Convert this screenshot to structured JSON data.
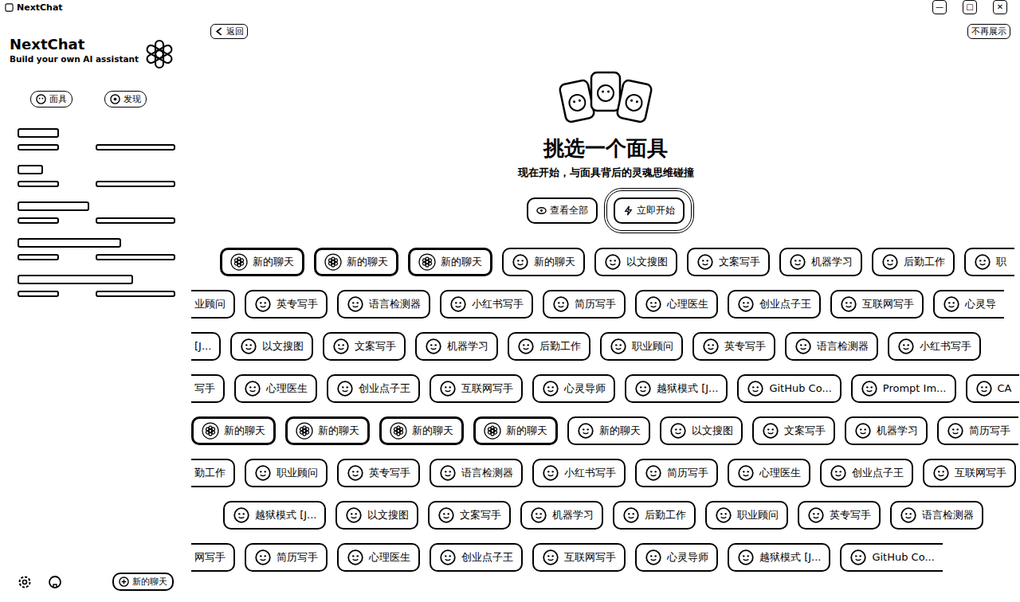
{
  "window": {
    "title": "NextChat",
    "controls": [
      "—",
      "□",
      "✕"
    ]
  },
  "sidebar": {
    "title": "NextChat",
    "subtitle": "Build your own AI assistant",
    "buttons": [
      {
        "label": "面具"
      },
      {
        "label": "发现"
      }
    ],
    "chats": [
      {
        "selected": false
      },
      {
        "selected": false
      },
      {
        "selected": false
      },
      {
        "selected": false
      },
      {
        "selected": false
      }
    ],
    "new_chat": "新的聊天"
  },
  "header": {
    "back": "返回",
    "dismiss": "不再展示"
  },
  "hero": {
    "title": "挑选一个面具",
    "subtitle": "现在开始，与面具背后的灵魂思维碰撞",
    "buttons": [
      {
        "label": "查看全部",
        "selected": false
      },
      {
        "label": "立即开始",
        "selected": true
      }
    ]
  },
  "mask_rows": [
    [
      {
        "label": "新的聊天",
        "kind": "gpt",
        "cut": "none"
      },
      {
        "label": "新的聊天",
        "kind": "gpt",
        "cut": "none"
      },
      {
        "label": "新的聊天",
        "kind": "gpt",
        "cut": "none"
      },
      {
        "label": "新的聊天",
        "kind": "emoji",
        "cut": "none"
      },
      {
        "label": "以文搜图",
        "kind": "emoji",
        "cut": "none"
      },
      {
        "label": "文案写手",
        "kind": "emoji",
        "cut": "none"
      },
      {
        "label": "机器学习",
        "kind": "emoji",
        "cut": "none"
      },
      {
        "label": "后勤工作",
        "kind": "emoji",
        "cut": "none"
      },
      {
        "label": "职",
        "kind": "emoji",
        "cut": "right"
      }
    ],
    [
      {
        "label": "业顾问",
        "kind": "none",
        "cut": "left"
      },
      {
        "label": "英专写手",
        "kind": "emoji",
        "cut": "none"
      },
      {
        "label": "语言检测器",
        "kind": "emoji",
        "cut": "none"
      },
      {
        "label": "小红书写手",
        "kind": "emoji",
        "cut": "none"
      },
      {
        "label": "简历写手",
        "kind": "emoji",
        "cut": "none"
      },
      {
        "label": "心理医生",
        "kind": "emoji",
        "cut": "none"
      },
      {
        "label": "创业点子王",
        "kind": "emoji",
        "cut": "none"
      },
      {
        "label": "互联网写手",
        "kind": "emoji",
        "cut": "none"
      },
      {
        "label": "心灵导",
        "kind": "emoji",
        "cut": "right"
      }
    ],
    [
      {
        "label": "[J...",
        "kind": "none",
        "cut": "left"
      },
      {
        "label": "以文搜图",
        "kind": "emoji",
        "cut": "none"
      },
      {
        "label": "文案写手",
        "kind": "emoji",
        "cut": "none"
      },
      {
        "label": "机器学习",
        "kind": "emoji",
        "cut": "none"
      },
      {
        "label": "后勤工作",
        "kind": "emoji",
        "cut": "none"
      },
      {
        "label": "职业顾问",
        "kind": "emoji",
        "cut": "none"
      },
      {
        "label": "英专写手",
        "kind": "emoji",
        "cut": "none"
      },
      {
        "label": "语言检测器",
        "kind": "emoji",
        "cut": "none"
      },
      {
        "label": "小红书写手",
        "kind": "emoji",
        "cut": "none"
      }
    ],
    [
      {
        "label": "写手",
        "kind": "none",
        "cut": "left"
      },
      {
        "label": "心理医生",
        "kind": "emoji",
        "cut": "none"
      },
      {
        "label": "创业点子王",
        "kind": "emoji",
        "cut": "none"
      },
      {
        "label": "互联网写手",
        "kind": "emoji",
        "cut": "none"
      },
      {
        "label": "心灵导师",
        "kind": "emoji",
        "cut": "none"
      },
      {
        "label": "越狱模式 [J...",
        "kind": "emoji",
        "cut": "none"
      },
      {
        "label": "GitHub Co...",
        "kind": "emoji",
        "cut": "none"
      },
      {
        "label": "Prompt Im...",
        "kind": "emoji",
        "cut": "none"
      },
      {
        "label": "CA",
        "kind": "emoji",
        "cut": "right"
      }
    ],
    [
      {
        "label": "新的聊天",
        "kind": "gpt",
        "cut": "none"
      },
      {
        "label": "新的聊天",
        "kind": "gpt",
        "cut": "none"
      },
      {
        "label": "新的聊天",
        "kind": "gpt",
        "cut": "none"
      },
      {
        "label": "新的聊天",
        "kind": "gpt",
        "cut": "none"
      },
      {
        "label": "新的聊天",
        "kind": "emoji",
        "cut": "none"
      },
      {
        "label": "以文搜图",
        "kind": "emoji",
        "cut": "none"
      },
      {
        "label": "文案写手",
        "kind": "emoji",
        "cut": "none"
      },
      {
        "label": "机器学习",
        "kind": "emoji",
        "cut": "none"
      },
      {
        "label": "简历写手",
        "kind": "emoji",
        "cut": "right"
      }
    ],
    [
      {
        "label": "勤工作",
        "kind": "none",
        "cut": "left"
      },
      {
        "label": "职业顾问",
        "kind": "emoji",
        "cut": "none"
      },
      {
        "label": "英专写手",
        "kind": "emoji",
        "cut": "none"
      },
      {
        "label": "语言检测器",
        "kind": "emoji",
        "cut": "none"
      },
      {
        "label": "小红书写手",
        "kind": "emoji",
        "cut": "none"
      },
      {
        "label": "简历写手",
        "kind": "emoji",
        "cut": "none"
      },
      {
        "label": "心理医生",
        "kind": "emoji",
        "cut": "none"
      },
      {
        "label": "创业点子王",
        "kind": "emoji",
        "cut": "none"
      },
      {
        "label": "互联网写手",
        "kind": "emoji",
        "cut": "none"
      }
    ],
    [
      {
        "label": "越狱模式 [J...",
        "kind": "emoji",
        "cut": "none"
      },
      {
        "label": "以文搜图",
        "kind": "emoji",
        "cut": "none"
      },
      {
        "label": "文案写手",
        "kind": "emoji",
        "cut": "none"
      },
      {
        "label": "机器学习",
        "kind": "emoji",
        "cut": "none"
      },
      {
        "label": "后勤工作",
        "kind": "emoji",
        "cut": "none"
      },
      {
        "label": "职业顾问",
        "kind": "emoji",
        "cut": "none"
      },
      {
        "label": "英专写手",
        "kind": "emoji",
        "cut": "none"
      },
      {
        "label": "语言检测器",
        "kind": "emoji",
        "cut": "none"
      }
    ],
    [
      {
        "label": "网写手",
        "kind": "none",
        "cut": "left"
      },
      {
        "label": "简历写手",
        "kind": "emoji",
        "cut": "none"
      },
      {
        "label": "心理医生",
        "kind": "emoji",
        "cut": "none"
      },
      {
        "label": "创业点子王",
        "kind": "emoji",
        "cut": "none"
      },
      {
        "label": "互联网写手",
        "kind": "emoji",
        "cut": "none"
      },
      {
        "label": "心灵导师",
        "kind": "emoji",
        "cut": "none"
      },
      {
        "label": "越狱模式 [J...",
        "kind": "emoji",
        "cut": "none"
      },
      {
        "label": "GitHub Co...",
        "kind": "emoji",
        "cut": "right"
      }
    ]
  ]
}
